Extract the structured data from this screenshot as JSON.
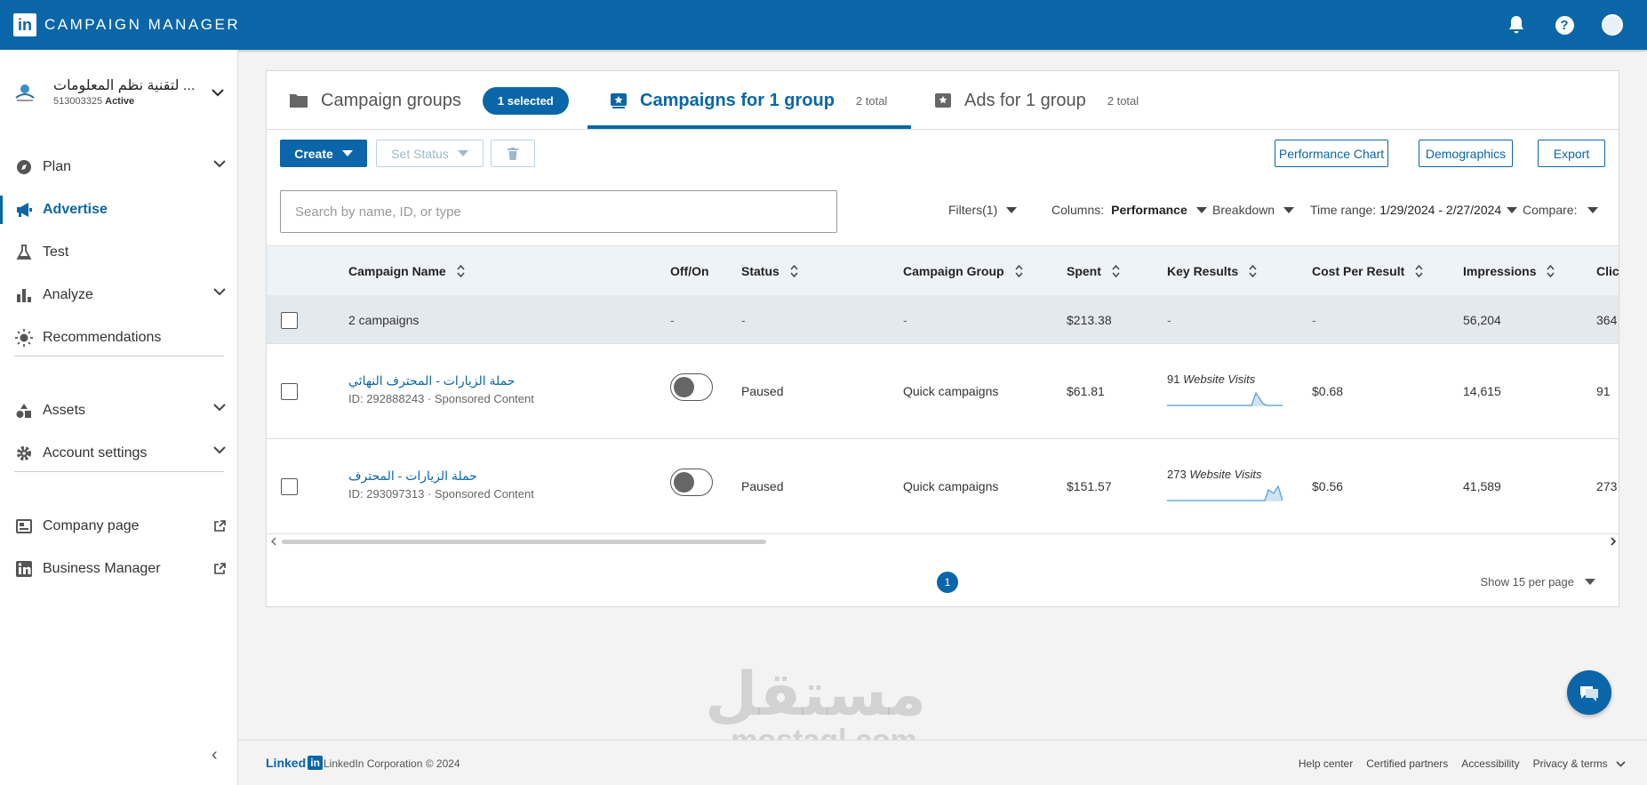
{
  "header": {
    "logo_text": "in",
    "title": "CAMPAIGN MANAGER",
    "icons": [
      "bell-icon",
      "help-icon",
      "account-avatar"
    ],
    "help_glyph": "?",
    "accent": "#0a66a8"
  },
  "account": {
    "name": "... لتقنية نظم المعلومات",
    "id": "513003325",
    "status": "Active"
  },
  "sidebar": {
    "items": [
      {
        "label": "Plan",
        "icon": "compass-icon",
        "expandable": true
      },
      {
        "label": "Advertise",
        "icon": "megaphone-icon",
        "active": true
      },
      {
        "label": "Test",
        "icon": "flask-icon"
      },
      {
        "label": "Analyze",
        "icon": "bar-chart-icon",
        "expandable": true
      },
      {
        "label": "Recommendations",
        "icon": "lightbulb-icon"
      },
      {
        "label": "Assets",
        "icon": "shapes-icon",
        "expandable": true
      },
      {
        "label": "Account settings",
        "icon": "gear-icon",
        "expandable": true
      },
      {
        "label": "Company page",
        "icon": "company-icon",
        "external": true
      },
      {
        "label": "Business Manager",
        "icon": "linkedin-icon",
        "external": true
      }
    ],
    "collapse_glyph": "‹"
  },
  "tabs": [
    {
      "label": "Campaign groups",
      "badge": "1 selected"
    },
    {
      "label": "Campaigns for 1 group",
      "count": "2 total",
      "active": true
    },
    {
      "label": "Ads for 1 group",
      "count": "2 total"
    }
  ],
  "toolbar": {
    "create": "Create",
    "set_status": "Set Status",
    "performance_chart": "Performance Chart",
    "demographics": "Demographics",
    "export": "Export"
  },
  "search": {
    "placeholder": "Search by name, ID, or type"
  },
  "filters": {
    "filters_label": "Filters",
    "filters_count": "(1)",
    "columns_label": "Columns:",
    "columns_value": "Performance",
    "breakdown": "Breakdown",
    "time_range_label": "Time range:",
    "time_range_value": "1/29/2024 - 2/27/2024",
    "compare": "Compare:"
  },
  "table": {
    "headers": {
      "name": "Campaign Name",
      "offon": "Off/On",
      "status": "Status",
      "group": "Campaign Group",
      "spent": "Spent",
      "key_results": "Key Results",
      "cpr": "Cost Per Result",
      "impressions": "Impressions",
      "clicks": "Clicks"
    },
    "summary": {
      "name": "2 campaigns",
      "offon": "-",
      "status": "-",
      "group": "-",
      "spent": "$213.38",
      "key_results": "-",
      "cpr": "-",
      "impressions": "56,204",
      "clicks": "364"
    },
    "rows": [
      {
        "name": "حملة الزيارات - المحترف النهائي",
        "meta": "ID: 292888243 · Sponsored Content",
        "toggle_on": false,
        "status": "Paused",
        "group": "Quick campaigns",
        "spent": "$61.81",
        "key_results_count": "91",
        "key_results_label": "Website Visits",
        "cpr": "$0.68",
        "impressions": "14,615",
        "clicks": "91"
      },
      {
        "name": "حملة الزيارات - المحترف",
        "meta": "ID: 293097313 · Sponsored Content",
        "toggle_on": false,
        "status": "Paused",
        "group": "Quick campaigns",
        "spent": "$151.57",
        "key_results_count": "273",
        "key_results_label": "Website Visits",
        "cpr": "$0.56",
        "impressions": "41,589",
        "clicks": "273"
      }
    ]
  },
  "pagination": {
    "page": "1",
    "per_page": "Show 15 per page"
  },
  "watermark": {
    "arabic": "مستقل",
    "latin": "mostaql.com"
  },
  "footer": {
    "logo_linked": "Linked",
    "logo_in": "in",
    "copyright": "LinkedIn Corporation © 2024",
    "links": [
      "Help center",
      "Certified partners",
      "Accessibility",
      "Privacy & terms"
    ]
  }
}
